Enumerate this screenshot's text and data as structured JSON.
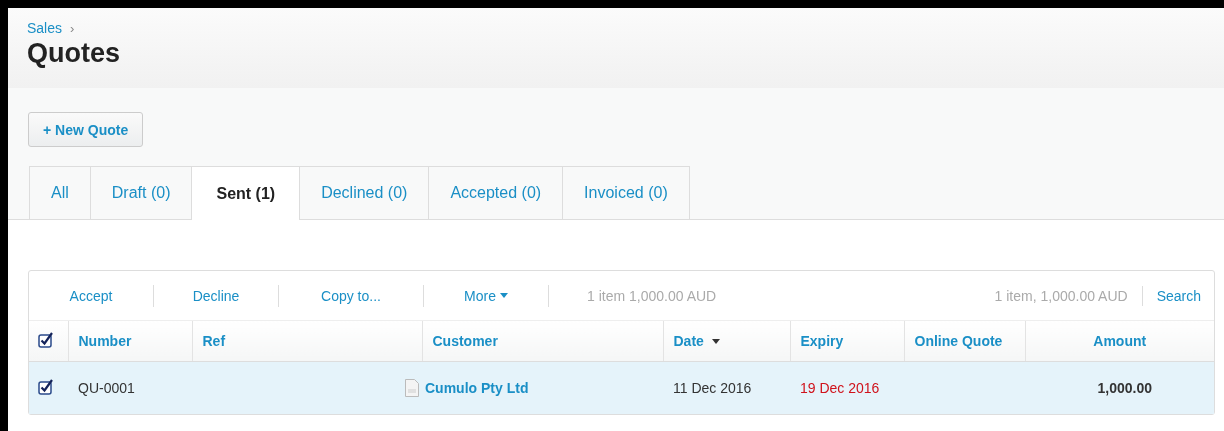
{
  "breadcrumb": {
    "link": "Sales",
    "separator": "›"
  },
  "title": "Quotes",
  "new_button": "+ New Quote",
  "tabs": [
    {
      "label": "All",
      "selected": false
    },
    {
      "label": "Draft (0)",
      "selected": false
    },
    {
      "label": "Sent (1)",
      "selected": true
    },
    {
      "label": "Declined (0)",
      "selected": false
    },
    {
      "label": "Accepted (0)",
      "selected": false
    },
    {
      "label": "Invoiced (0)",
      "selected": false
    }
  ],
  "toolbar": {
    "actions": [
      {
        "label": "Accept",
        "dropdown": false
      },
      {
        "label": "Decline",
        "dropdown": false
      },
      {
        "label": "Copy to...",
        "dropdown": false
      },
      {
        "label": "More",
        "dropdown": true
      }
    ],
    "selection_summary": "1 item 1,000.00 AUD",
    "total_summary": "1 item, 1,000.00 AUD",
    "search": "Search"
  },
  "table": {
    "select_all_checked": true,
    "columns": [
      {
        "label": "Number",
        "sorted": false
      },
      {
        "label": "Ref",
        "sorted": false
      },
      {
        "label": "Customer",
        "sorted": false
      },
      {
        "label": "Date",
        "sorted": true
      },
      {
        "label": "Expiry",
        "sorted": false
      },
      {
        "label": "Online Quote",
        "sorted": false
      },
      {
        "label": "Amount",
        "sorted": false
      }
    ],
    "rows": [
      {
        "checked": true,
        "selected": true,
        "number": "QU-0001",
        "customer": "Cumulo Pty Ltd",
        "date": "11 Dec 2016",
        "expiry": "19 Dec 2016",
        "expired": true,
        "amount": "1,000.00"
      }
    ]
  }
}
